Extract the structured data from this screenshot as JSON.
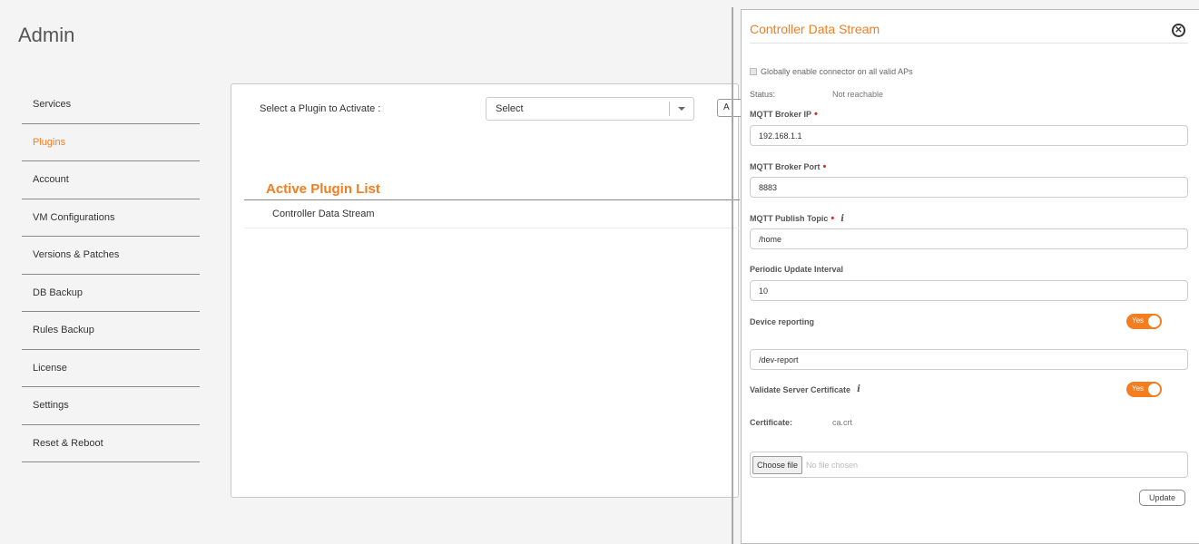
{
  "page": {
    "title": "Admin"
  },
  "sidebar": {
    "items": [
      {
        "label": "Services"
      },
      {
        "label": "Plugins",
        "active": true
      },
      {
        "label": "Account"
      },
      {
        "label": "VM Configurations"
      },
      {
        "label": "Versions & Patches"
      },
      {
        "label": "DB Backup"
      },
      {
        "label": "Rules Backup"
      },
      {
        "label": "License"
      },
      {
        "label": "Settings"
      },
      {
        "label": "Reset & Reboot"
      }
    ]
  },
  "main": {
    "select_label": "Select a Plugin to Activate :",
    "select_value": "Select",
    "activate_button_label": "A",
    "active_list_title": "Active Plugin List",
    "active_plugins": [
      "Controller Data Stream"
    ]
  },
  "drawer": {
    "title": "Controller Data Stream",
    "global_enable_label": "Globally enable connector on all valid APs",
    "status_label": "Status:",
    "status_value": "Not reachable",
    "broker_ip_label": "MQTT Broker IP",
    "broker_ip_value": "192.168.1.1",
    "broker_port_label": "MQTT Broker Port",
    "broker_port_value": "8883",
    "publish_topic_label": "MQTT Publish Topic",
    "publish_topic_value": "/home",
    "periodic_label": "Periodic Update Interval",
    "periodic_value": "10",
    "device_reporting_label": "Device reporting",
    "device_reporting_toggle": "Yes",
    "device_report_value": "/dev-report",
    "validate_cert_label": "Validate Server Certificate",
    "validate_cert_toggle": "Yes",
    "certificate_label": "Certificate:",
    "certificate_value": "ca.crt",
    "choose_file_label": "Choose file",
    "no_file_label": "No file chosen",
    "update_label": "Update",
    "required_mark": "•",
    "info_glyph": "i",
    "close_glyph": "✕"
  },
  "colors": {
    "accent": "#f47d20",
    "required": "#e0252a"
  },
  "icons": [
    "close-icon",
    "info-icon",
    "chevron-down-icon"
  ]
}
